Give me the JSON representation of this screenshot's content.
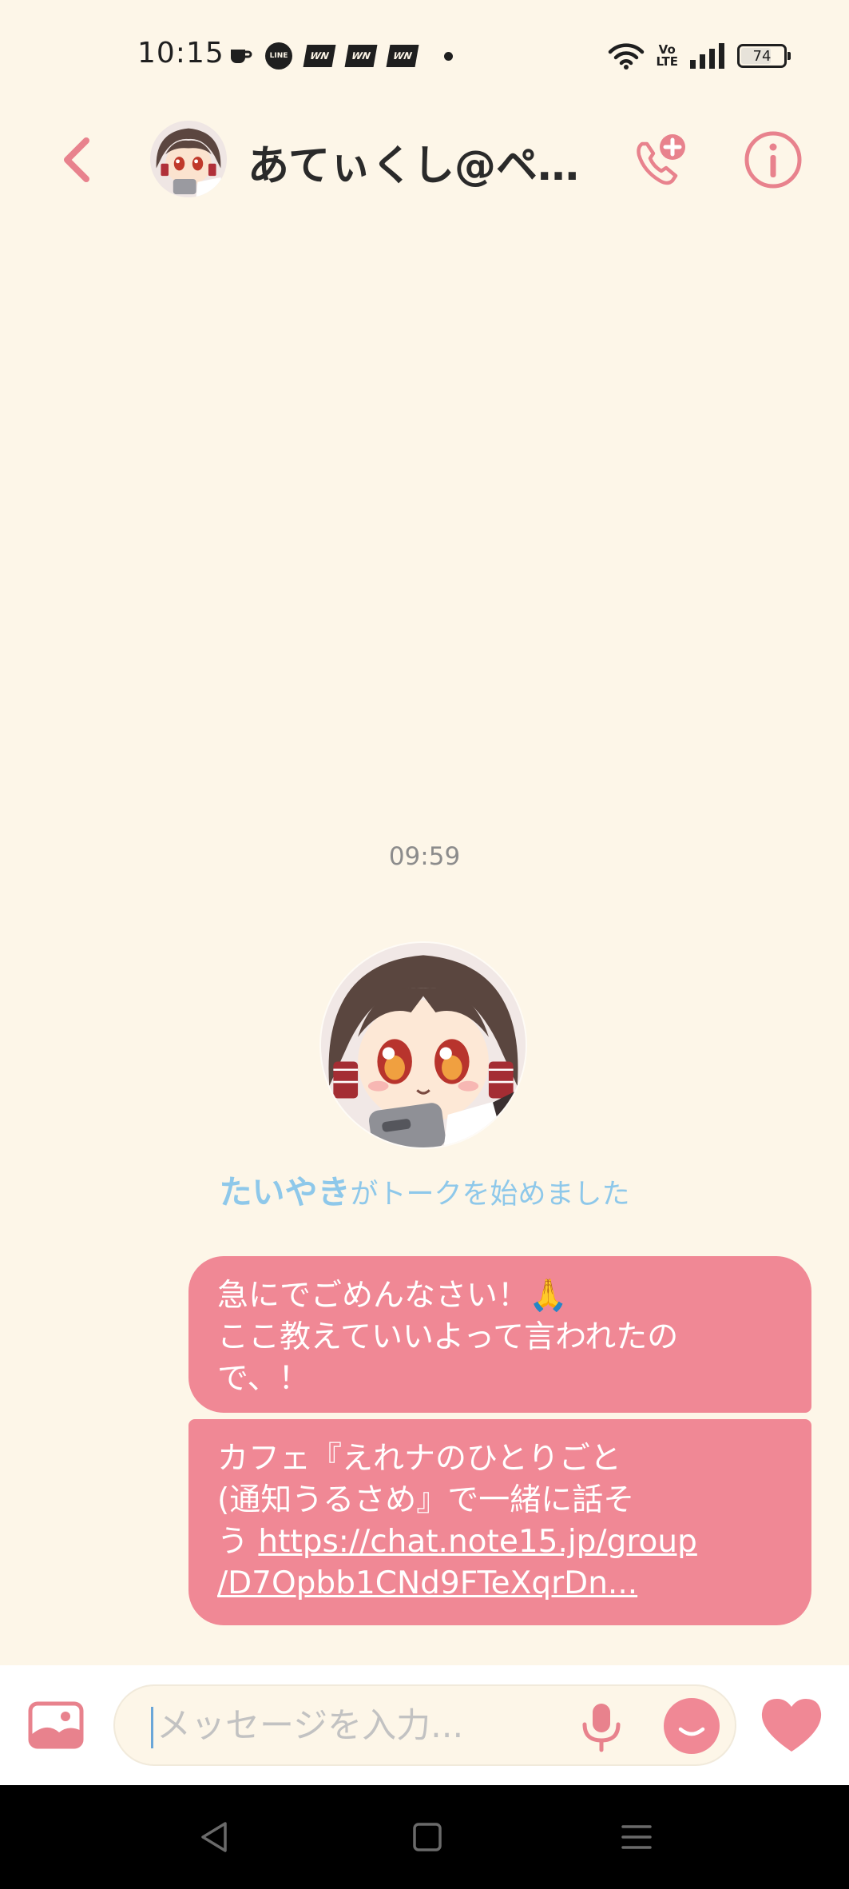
{
  "status_bar": {
    "time": "10:15",
    "line_label": "LINE",
    "wn_labels": [
      "WN",
      "WN",
      "WN"
    ],
    "volte_top": "Vo",
    "volte_bottom": "LTE",
    "battery_level": "74",
    "battery_fraction": 0.74,
    "icons": [
      "coffee-icon",
      "line-icon",
      "wn-icon",
      "wn-icon",
      "wn-icon",
      "dot-icon",
      "wifi-icon",
      "volte-icon",
      "signal-icon",
      "battery-icon"
    ]
  },
  "header": {
    "title": "あてぃくし@ペア...",
    "back_icon": "chevron-left-icon",
    "call_icon": "add-call-icon",
    "info_icon": "info-icon"
  },
  "chat": {
    "timestamp": "09:59",
    "system_name": "たいやき",
    "system_text": "がトークを始めました",
    "messages": [
      {
        "text": "急にでごめんなさい！🙏\nここ教えていいよって言われたの\nで、！"
      },
      {
        "text_before_link": "カフェ『えれナのひとりごと\n(通知うるさめ』で一緒に話そ\nう ",
        "link_line1": "https://chat.note15.jp/group",
        "link_line2": "/D7Opbb1CNd9FTeXqrDn..."
      }
    ]
  },
  "input_bar": {
    "placeholder": "メッセージを入力...",
    "value": "",
    "gallery_icon": "image-icon",
    "mic_icon": "microphone-icon",
    "emoji_icon": "emoji-icon",
    "like_icon": "heart-icon"
  },
  "nav_bar": {
    "icons": [
      "back-triangle-icon",
      "home-square-icon",
      "menu-lines-icon"
    ]
  },
  "colors": {
    "background": "#fdf6e8",
    "accent": "#f08895",
    "accent_dark": "#e8828d",
    "system_blue": "#8ec8ea"
  }
}
